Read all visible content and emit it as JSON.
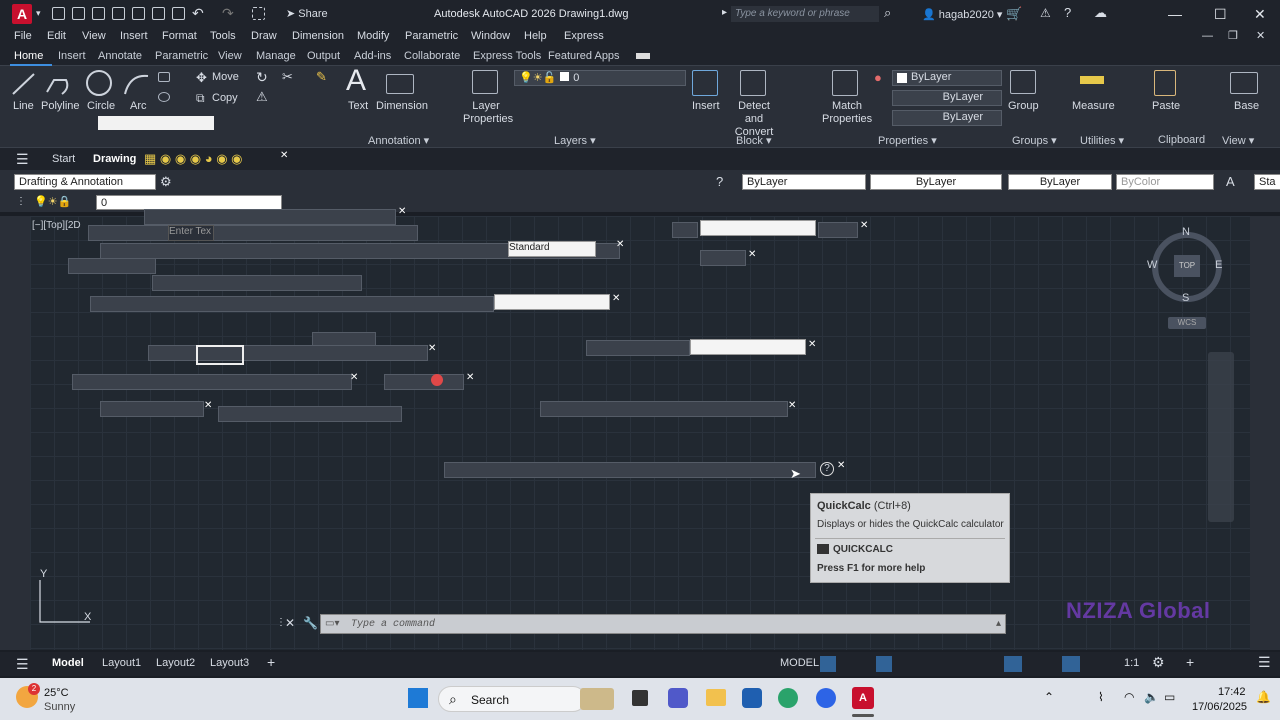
{
  "app": {
    "logo_letter": "A",
    "title": "Autodesk AutoCAD 2026    Drawing1.dwg",
    "share_label": "Share",
    "search_placeholder": "Type a keyword or phrase",
    "user": "hagab2020"
  },
  "menus": [
    "File",
    "Edit",
    "View",
    "Insert",
    "Format",
    "Tools",
    "Draw",
    "Dimension",
    "Modify",
    "Parametric",
    "Window",
    "Help",
    "Express"
  ],
  "ribbon_tabs": [
    "Home",
    "Insert",
    "Annotate",
    "Parametric",
    "View",
    "Manage",
    "Output",
    "Add-ins",
    "Collaborate",
    "Express Tools",
    "Featured Apps"
  ],
  "draw_tools": [
    "Line",
    "Polyline",
    "Circle",
    "Arc"
  ],
  "modify_tools": [
    "Move",
    "Copy"
  ],
  "annotation": {
    "text": "Text",
    "dimension": "Dimension",
    "panel": "Annotation ▾"
  },
  "layers": {
    "props": "Layer Properties",
    "current": "0",
    "panel": "Layers ▾"
  },
  "block": {
    "insert": "Insert",
    "detect": "Detect and Convert",
    "panel": "Block ▾"
  },
  "properties": {
    "match": "Match Properties",
    "layer1": "ByLayer",
    "layer2": "ByLayer",
    "layer3": "ByLayer",
    "panel": "Properties ▾"
  },
  "groups": {
    "label": "Group",
    "panel": "Groups ▾"
  },
  "utilities": {
    "label": "Measure",
    "panel": "Utilities ▾"
  },
  "clipboard": {
    "label": "Paste",
    "panel": "Clipboard"
  },
  "view": {
    "label": "Base",
    "panel": "View ▾"
  },
  "filetabs": {
    "start": "Start",
    "drawing": "Drawing"
  },
  "workspace": "Drafting & Annotation",
  "prop_combos": {
    "color": "ByLayer",
    "linetype": "ByLayer",
    "lineweight": "ByLayer",
    "plotstyle": "ByColor",
    "st": "Sta"
  },
  "layer_current": "0",
  "viewport_label": "[−][Top][2D",
  "enter_text": "Enter Tex",
  "standard_combo": "Standard",
  "viewcube": {
    "n": "N",
    "s": "S",
    "e": "E",
    "w": "W",
    "top": "TOP",
    "wcs": "WCS"
  },
  "tooltip": {
    "title": "QuickCalc",
    "shortcut": "(Ctrl+8)",
    "desc": "Displays or hides the QuickCalc calculator",
    "command": "QUICKCALC",
    "help": "Press F1 for more help"
  },
  "command_placeholder": "Type a command",
  "layout_tabs": [
    "Model",
    "Layout1",
    "Layout2",
    "Layout3"
  ],
  "status": {
    "model": "MODEL",
    "scale": "1:1"
  },
  "watermark": "NZIZA Global",
  "taskbar": {
    "temp": "25°C",
    "weather": "Sunny",
    "search": "Search",
    "time": "17:42",
    "date": "17/06/2025",
    "badge": "2"
  },
  "axis": {
    "y": "Y",
    "x": "X"
  }
}
